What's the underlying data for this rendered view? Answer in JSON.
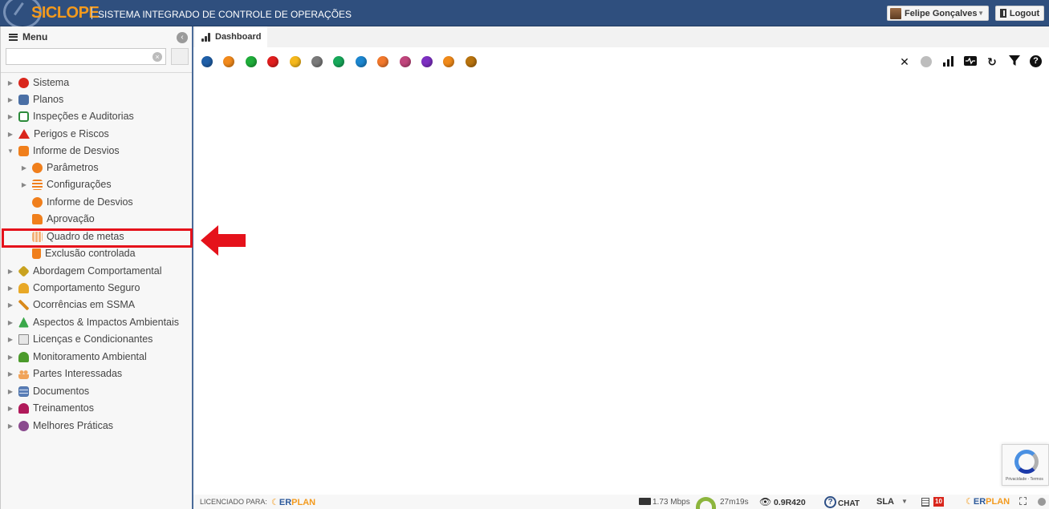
{
  "header": {
    "logo": "SICLOPE",
    "system_name": "SISTEMA INTEGRADO DE CONTROLE DE OPERAÇÕES",
    "user_name": "Felipe Gonçalves",
    "logout_label": "Logout"
  },
  "sidebar": {
    "menu_label": "Menu",
    "search_value": "",
    "items": [
      {
        "label": "Sistema",
        "icon": "gear-red-icon"
      },
      {
        "label": "Planos",
        "icon": "calendar-icon"
      },
      {
        "label": "Inspeções e Auditorias",
        "icon": "clipboard-check-icon"
      },
      {
        "label": "Perigos e Riscos",
        "icon": "warning-icon"
      },
      {
        "label": "Informe de Desvios",
        "icon": "folder-open-icon"
      },
      {
        "label": "Parâmetros",
        "icon": "gear-orange-icon"
      },
      {
        "label": "Configurações",
        "icon": "sliders-icon"
      },
      {
        "label": "Informe de Desvios",
        "icon": "whatsapp-icon"
      },
      {
        "label": "Aprovação",
        "icon": "thumbs-up-icon"
      },
      {
        "label": "Quadro de metas",
        "icon": "grid-icon"
      },
      {
        "label": "Exclusão controlada",
        "icon": "trash-icon"
      },
      {
        "label": "Abordagem Comportamental",
        "icon": "diamond-icon"
      },
      {
        "label": "Comportamento Seguro",
        "icon": "hardhat-icon"
      },
      {
        "label": "Ocorrências em SSMA",
        "icon": "falling-person-icon"
      },
      {
        "label": "Aspectos & Impactos Ambientais",
        "icon": "recycle-icon"
      },
      {
        "label": "Licenças e Condicionantes",
        "icon": "document-icon"
      },
      {
        "label": "Monitoramento Ambiental",
        "icon": "tree-icon"
      },
      {
        "label": "Partes Interessadas",
        "icon": "people-icon"
      },
      {
        "label": "Documentos",
        "icon": "table-icon"
      },
      {
        "label": "Treinamentos",
        "icon": "teacher-icon"
      },
      {
        "label": "Melhores Práticas",
        "icon": "award-icon"
      }
    ]
  },
  "tabs": [
    {
      "label": "Dashboard",
      "icon": "bar-chart-icon"
    }
  ],
  "colors": {
    "header_bg": "#2f4f7e",
    "accent_orange": "#f39a1d",
    "highlight_red": "#e5121b",
    "dots": [
      "#1f5fa8",
      "#f28a1c",
      "#1fad3a",
      "#e01e1e",
      "#f5b81c",
      "#7a7a7a",
      "#17a85a",
      "#1c86cf",
      "#f2782c",
      "#c0457c",
      "#7d2fc2",
      "#f08a1a",
      "#b8730e"
    ]
  },
  "status": {
    "licensed_label": "LICENCIADO PARA:",
    "brand_er": "ER",
    "brand_plan": "PLAN",
    "bandwidth": "1.73 Mbps",
    "session_time": "27m19s",
    "version": "0.9R420",
    "chat_label": "CHAT",
    "sla_label": "SLA",
    "badge_count": "10",
    "recaptcha_text": "Privacidade - Termos"
  }
}
